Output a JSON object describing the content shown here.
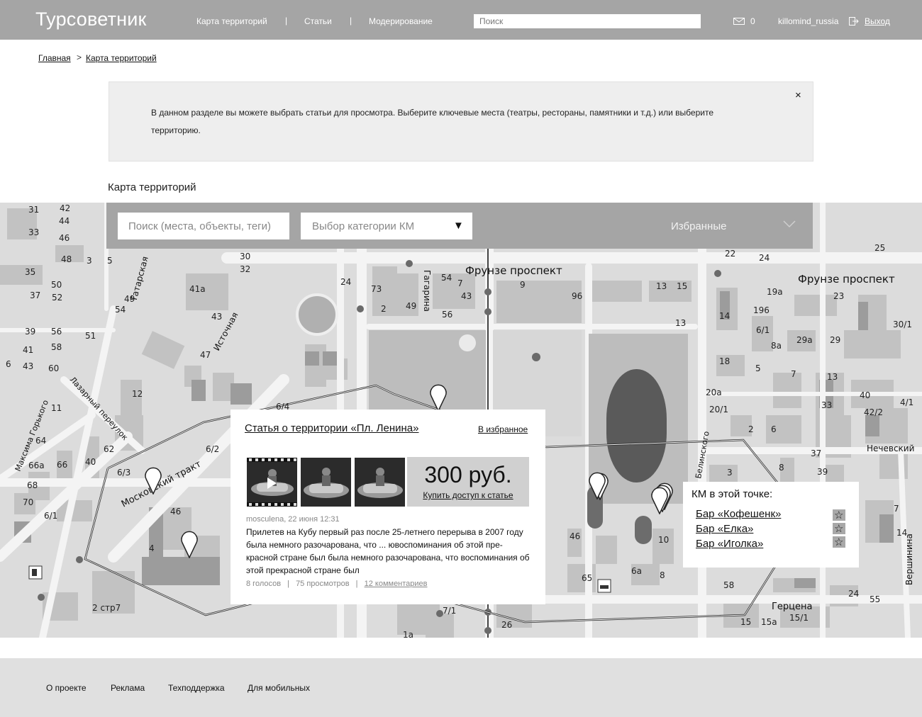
{
  "header": {
    "logo": "Турсоветник",
    "nav": [
      "Карта территорий",
      "Статьи",
      "Модерирование"
    ],
    "nav_separator": "|",
    "search_placeholder": "Поиск",
    "mail_count": "0",
    "username": "killomind_russia",
    "logout": "Выход"
  },
  "breadcrumb": {
    "items": [
      "Главная",
      "Карта территорий"
    ],
    "separator": ">"
  },
  "info": {
    "text": "В данном разделе вы можете выбрать статьи для просмотра. Выберите ключевые места (театры, рестораны, памятники и т.д.) или выберите территорию.",
    "close": "×"
  },
  "section_title": "Карта территорий",
  "map_toolbar": {
    "search_placeholder": "Поиск (места, объекты, теги)",
    "category_label": "Выбор категории КМ",
    "category_arrow": "▼",
    "favorites": "Избранные"
  },
  "map": {
    "street_labels": [
      "Фрунзе проспект",
      "Фрунзе проспект",
      "Московский тракт",
      "Татарская",
      "Источная",
      "Максима Горького",
      "Лазарный переулок",
      "Гагарина",
      "Нечевский",
      "Герцена",
      "Вершинина",
      "Белинского"
    ],
    "house_numbers": [
      "31",
      "42",
      "44",
      "46",
      "33",
      "48",
      "3",
      "5",
      "30",
      "32",
      "35",
      "37",
      "50",
      "52",
      "54",
      "39",
      "56",
      "58",
      "41",
      "43",
      "60",
      "6",
      "11",
      "12",
      "64",
      "66a",
      "66",
      "68",
      "70",
      "6/1",
      "2 стр7",
      "46",
      "4",
      "41a",
      "43",
      "47",
      "49",
      "51",
      "24",
      "73",
      "2",
      "49",
      "54",
      "7",
      "43",
      "56",
      "9",
      "96",
      "13",
      "15",
      "13",
      "22",
      "24",
      "23",
      "25",
      "19a",
      "196",
      "6/1",
      "29a",
      "29",
      "30/1",
      "14",
      "8a",
      "18",
      "5",
      "7",
      "13",
      "20a",
      "20/1",
      "33",
      "2",
      "6",
      "40",
      "42/2",
      "4/1",
      "37",
      "39",
      "8",
      "3",
      "7",
      "14",
      "58",
      "24",
      "55",
      "15/1",
      "15",
      "15a",
      "10",
      "8",
      "6a",
      "65",
      "46",
      "1a",
      "26",
      "7/1",
      "6/4",
      "6/2",
      "6/3",
      "62",
      "40"
    ]
  },
  "popup": {
    "title": "Статья  о территории «Пл. Ленина»",
    "favorite": "В избранное",
    "price": "300 руб.",
    "buy": "Купить доступ к статье",
    "meta": "mosculena, 22 июня 12:31",
    "body": "Прилетев на Кубу первый раз после 25-летнего перерыва в 2007 году  была немного разочарована, что ... ювоспоминания об этой пре-красной стране был  была немного разочарована, что воспоминания об этой прекрасной стране был",
    "votes": "8 голосов",
    "views": "75 просмотров",
    "comments": "12 комментариев",
    "stats_separator": "|"
  },
  "km_panel": {
    "title": "КМ в этой точке:",
    "items": [
      "Бар «Кофешенк»",
      "Бар «Елка»",
      "Бар «Иголка»"
    ],
    "star": "☆"
  },
  "footer": {
    "links": [
      "О проекте",
      "Реклама",
      "Техподдержка",
      "Для мобильных"
    ]
  },
  "colors": {
    "header_bg": "#a5a5a5",
    "map_bg": "#dcdcdc",
    "info_bg": "#eeeeee",
    "footer_bg": "#e0e0e0",
    "price_bg": "#d0d0d0"
  }
}
